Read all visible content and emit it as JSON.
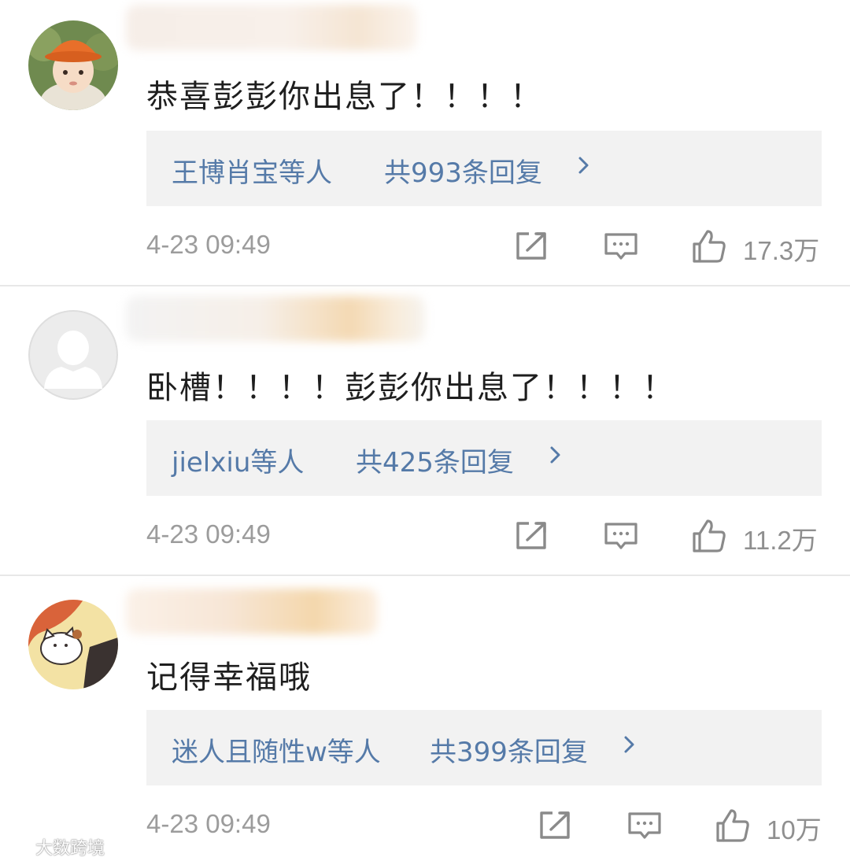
{
  "comments": [
    {
      "text": "恭喜彭彭你出息了！！！！",
      "reply_users": "王博肖宝等人",
      "reply_count": "共993条回复",
      "time": "4-23 09:49",
      "likes": "17.3万"
    },
    {
      "text": "卧槽！！！！彭彭你出息了！！！！",
      "reply_users": "jielxiu等人",
      "reply_count": "共425条回复",
      "time": "4-23 09:49",
      "likes": "11.2万"
    },
    {
      "text": "记得幸福哦",
      "reply_users": "迷人且随性w等人",
      "reply_count": "共399条回复",
      "time": "4-23 09:49",
      "likes": "10万"
    }
  ],
  "icons": {
    "share": "share-icon",
    "comment": "comment-icon",
    "like": "thumbs-up-icon",
    "chevron": "chevron-right-icon"
  },
  "colors": {
    "link": "#557aa8",
    "meta": "#9c9c9c",
    "reply_bg": "#f2f2f2"
  },
  "watermark": "大数跨境"
}
